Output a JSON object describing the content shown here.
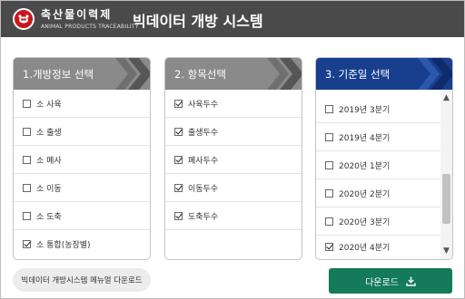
{
  "brand": {
    "name": "축산물이력제",
    "subtitle": "ANIMAL PRODUCTS TRACEABILITY"
  },
  "app_title": "빅데이터 개방 시스템",
  "panels": [
    {
      "title": "1.개방정보 선택",
      "items": [
        {
          "label": "소 사육",
          "checked": false
        },
        {
          "label": "소 출생",
          "checked": false
        },
        {
          "label": "소 폐사",
          "checked": false
        },
        {
          "label": "소 이동",
          "checked": false
        },
        {
          "label": "소 도축",
          "checked": false
        },
        {
          "label": "소 통합(농장별)",
          "checked": true
        }
      ]
    },
    {
      "title": "2. 항목선택",
      "items": [
        {
          "label": "사육두수",
          "checked": true
        },
        {
          "label": "출생두수",
          "checked": true
        },
        {
          "label": "폐사두수",
          "checked": true
        },
        {
          "label": "이동두수",
          "checked": true
        },
        {
          "label": "도축두수",
          "checked": true
        }
      ]
    },
    {
      "title": "3. 기준일 선택",
      "items": [
        {
          "label": "2019년 3분기",
          "checked": false
        },
        {
          "label": "2019년 4분기",
          "checked": false
        },
        {
          "label": "2020년 1분기",
          "checked": false
        },
        {
          "label": "2020년 2분기",
          "checked": false
        },
        {
          "label": "2020년 3분기",
          "checked": false
        },
        {
          "label": "2020년 4분기",
          "checked": true
        }
      ]
    }
  ],
  "manual_button": "빅데이터 개방시스템 메뉴얼 다운로드",
  "download_button": "다운로드",
  "colors": {
    "header_bg": "#4a4a4a",
    "panel_head_gray": "#8a8a8a",
    "panel_head_active": "#173f8e",
    "download_green": "#147a5a",
    "logo_red": "#c8161d"
  },
  "icons": {
    "logo": "cow-badge-icon",
    "download": "download-icon",
    "scroll_up": "chevron-up-icon",
    "scroll_down": "chevron-down-icon"
  }
}
